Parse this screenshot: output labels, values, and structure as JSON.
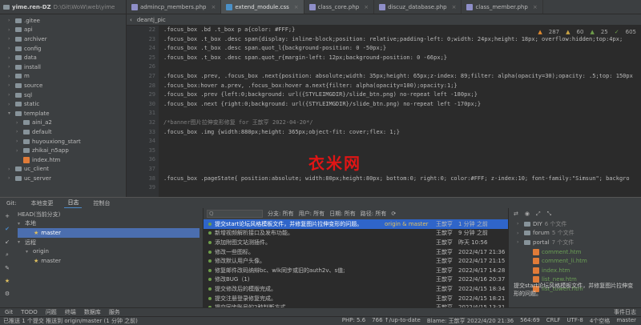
{
  "project": {
    "root": "yime.ren-DZ",
    "path": "D:\\Git\\WoW\\web\\yime"
  },
  "tabs": [
    {
      "label": "admincp_members.php",
      "color": "#8e8ec8"
    },
    {
      "label": "extend_module.css",
      "color": "#4a90c8",
      "active": true
    },
    {
      "label": "class_core.php",
      "color": "#8e8ec8"
    },
    {
      "label": "discuz_database.php",
      "color": "#8e8ec8"
    },
    {
      "label": "class_member.php",
      "color": "#8e8ec8"
    }
  ],
  "crumb": {
    "item": "deantj_pic"
  },
  "tree": [
    {
      "name": ".gitee",
      "level": 1,
      "folder": true
    },
    {
      "name": "api",
      "level": 1,
      "folder": true
    },
    {
      "name": "archiver",
      "level": 1,
      "folder": true
    },
    {
      "name": "config",
      "level": 1,
      "folder": true
    },
    {
      "name": "data",
      "level": 1,
      "folder": true
    },
    {
      "name": "install",
      "level": 1,
      "folder": true
    },
    {
      "name": "m",
      "level": 1,
      "folder": true
    },
    {
      "name": "source",
      "level": 1,
      "folder": true
    },
    {
      "name": "sql",
      "level": 1,
      "folder": true
    },
    {
      "name": "static",
      "level": 1,
      "folder": true
    },
    {
      "name": "template",
      "level": 1,
      "folder": true,
      "open": true
    },
    {
      "name": "aini_a2",
      "level": 2,
      "folder": true
    },
    {
      "name": "default",
      "level": 2,
      "folder": true
    },
    {
      "name": "huyouxiong_start",
      "level": 2,
      "folder": true
    },
    {
      "name": "zhikai_n5app",
      "level": 2,
      "folder": true
    },
    {
      "name": "index.htm",
      "level": 2,
      "folder": false
    },
    {
      "name": "uc_client",
      "level": 1,
      "folder": true
    },
    {
      "name": "uc_server",
      "level": 1,
      "folder": true
    }
  ],
  "gutter": [
    "22",
    "23",
    "24",
    "25",
    "26",
    "27",
    "28",
    "29",
    "30",
    "31",
    "32",
    "33",
    "34",
    "35",
    "36",
    "37",
    "38",
    "39"
  ],
  "code": [
    ".focus_box .bd .t_box p a{color: #FFF;}",
    ".focus_box .t_box .desc span{display: inline-block;position: relative;padding-left: 0;width: 24px;height: 18px; overflow:hidden;top:4px;",
    ".focus_box .t_box .desc span.quot_l{background-position: 0 -50px;}",
    ".focus_box .t_box .desc span.quot_r{margin-left: 12px;background-position: 0 -66px;}",
    "",
    ".focus_box .prev, .focus_box .next{position: absolute;width: 35px;height: 65px;z-index: 89;filter: alpha(opacity=30);opacity: .5;top: 150px",
    ".focus_box:hover a.prev, .focus_box:hover a.next{filter: alpha(opacity=100);opacity:1;}",
    ".focus_box .prev {left:0;background: url({STYLEIMGDIR}/slide_btn.png) no-repeat left -180px;}",
    ".focus_box .next {right:0;background: url({STYLEIMGDIR}/slide_btn.png) no-repeat left -170px;}",
    "",
    "/*banner图片拉伸变形修复 for 王歆亨 2022-04-20*/",
    ".focus_box .img {width:880px;height: 365px;object-fit: cover;flex: 1;}",
    "",
    "",
    "",
    "",
    ".focus_box .pageState{ position:absolute; width:80px;height:80px; bottom:0; right:0; color:#FFF; z-index:10; font-family:\"Simsun\"; backgro",
    ""
  ],
  "editor_status": {
    "warnings": "287",
    "weak": "60",
    "typos": "25",
    "info": "605"
  },
  "watermark": "衣米网",
  "git_tabs": [
    "Git:",
    "本地变更",
    "日志",
    "控制台"
  ],
  "git_active_tab": 2,
  "branches": [
    {
      "label": "HEAD(当前分支)",
      "level": 0
    },
    {
      "label": "本地",
      "level": 0,
      "caret": true
    },
    {
      "label": "master",
      "level": 2,
      "hl": true,
      "star": true
    },
    {
      "label": "远程",
      "level": 0,
      "caret": true
    },
    {
      "label": "origin",
      "level": 1,
      "caret": true
    },
    {
      "label": "master",
      "level": 2,
      "star": true
    }
  ],
  "log_filter": {
    "placeholder": "Q",
    "branch": "分支: 所有",
    "user": "用户: 所有",
    "date": "日期: 所有",
    "path": "路径: 所有"
  },
  "commits": [
    {
      "msg": "提交start论坛风格模板文件，并修复图片拉伸变形的问题。",
      "tag": "origin & master",
      "author": "王歆亨",
      "date": "1 分钟 之前",
      "hl": true
    },
    {
      "msg": "新增视频解析接口及发布功能。",
      "tag": "",
      "author": "王歆亨",
      "date": "9 分钟 之前"
    },
    {
      "msg": "添加附图文站测插件。",
      "tag": "",
      "author": "王歆亨",
      "date": "昨天 10:56"
    },
    {
      "msg": "修改一些图标。",
      "tag": "",
      "author": "王歆亨",
      "date": "2022/4/17 21:36"
    },
    {
      "msg": "修改默认用户头像。",
      "tag": "",
      "author": "王歆亨",
      "date": "2022/4/17 21:15"
    },
    {
      "msg": "修复邮件改码纳辩bc、wlk同步或旧的auth2v、s值;",
      "tag": "",
      "author": "王歆亨",
      "date": "2022/4/17 14:28"
    },
    {
      "msg": "修改BUG（1)",
      "tag": "",
      "author": "王歆亨",
      "date": "2022/4/16 20:37"
    },
    {
      "msg": "提交修改后的模版完成。",
      "tag": "",
      "author": "王歆亨",
      "date": "2022/4/15 18:34"
    },
    {
      "msg": "提交注册登录修复完成。",
      "tag": "",
      "author": "王歆亨",
      "date": "2022/4/15 18:21"
    },
    {
      "msg": "提交同步账号的2种判断方式",
      "tag": "",
      "author": "王歆亨",
      "date": "2022/4/15 13:31"
    }
  ],
  "changes": [
    {
      "label": "DIY",
      "cnt": "6 个文件",
      "type": "dir"
    },
    {
      "label": "forum",
      "cnt": "5 个文件",
      "type": "dir"
    },
    {
      "label": "portal",
      "cnt": "7 个文件",
      "type": "dir"
    },
    {
      "label": "comment.htm",
      "type": "file"
    },
    {
      "label": "comment_li.htm",
      "type": "file"
    },
    {
      "label": "index.htm",
      "type": "file"
    },
    {
      "label": "list_new.htm",
      "type": "file"
    },
    {
      "label": "list_tuwen.htm",
      "type": "file"
    }
  ],
  "commit_detail": "提交start论坛风格模板文件，并修复图片拉伸变形的问题。",
  "bottom_tabs": [
    "Git",
    "TODO",
    "问题",
    "终端",
    "数据库",
    "服务"
  ],
  "bottom_right": "事件日志",
  "status": {
    "left": "已推送 1 个提交 推送到 origin/master (1 分钟 之前)",
    "php": "PHP: 5.6",
    "updates": "766 ↑/up-to-date",
    "blame": "Blame: 王歆亨 2022/4/20 21:36",
    "pos": "564:69",
    "crlf": "CRLF",
    "enc": "UTF-8",
    "indent": "4个空格",
    "branch": "master"
  }
}
